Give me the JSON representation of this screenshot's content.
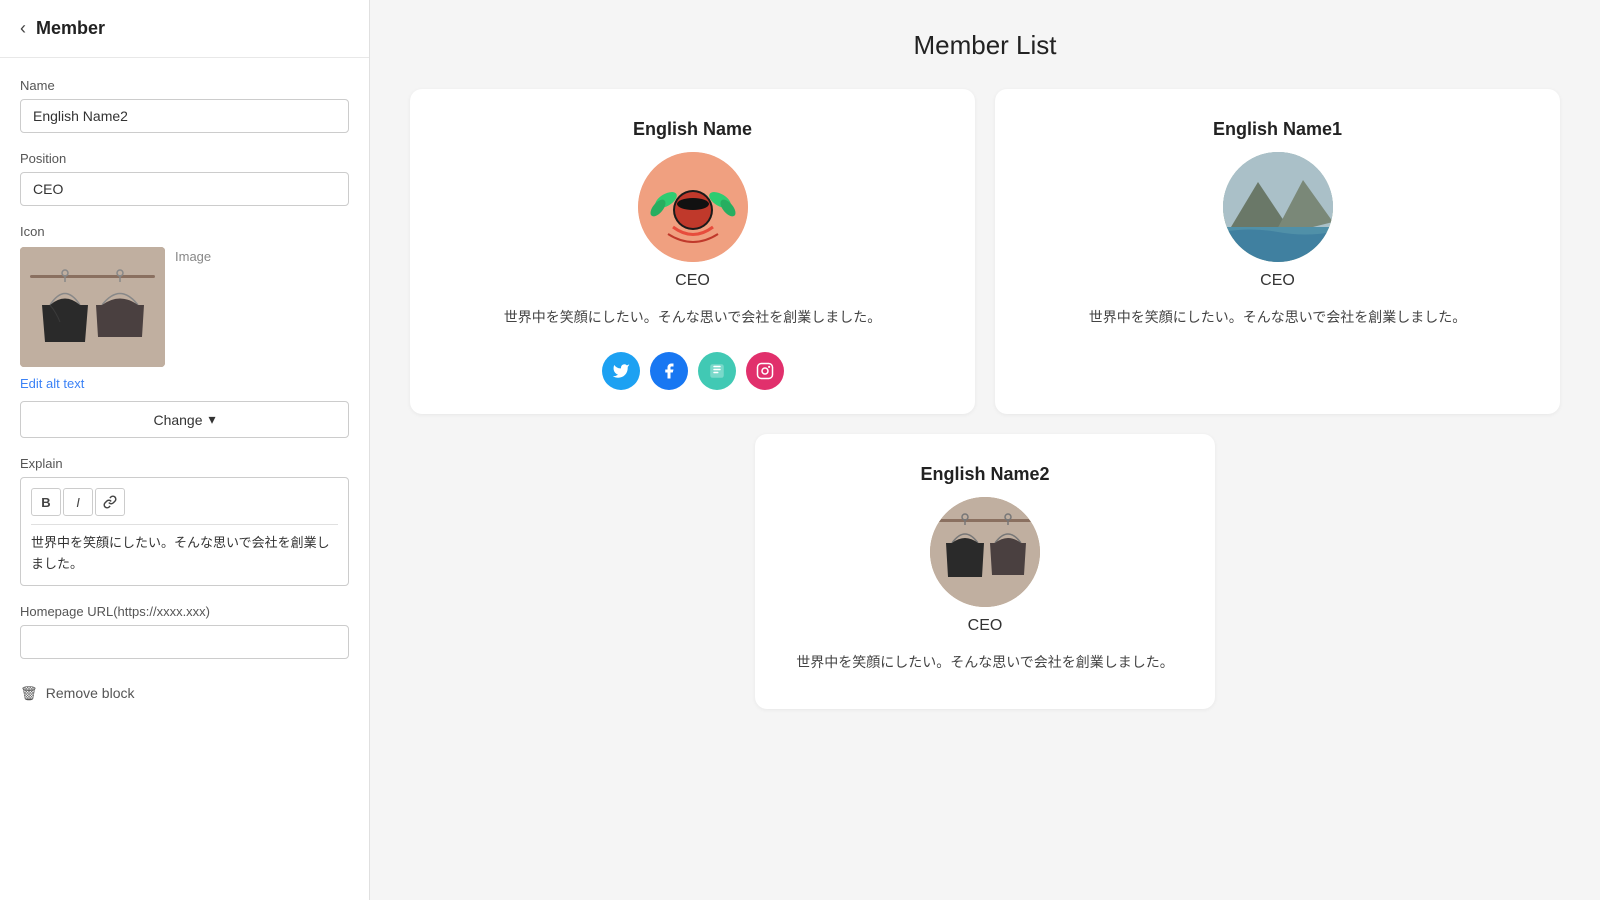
{
  "sidebar": {
    "title": "Member",
    "back_label": "‹",
    "name_label": "Name",
    "name_value": "English Name2",
    "position_label": "Position",
    "position_value": "CEO",
    "icon_label": "Icon",
    "image_label": "Image",
    "edit_alt_text_label": "Edit alt text",
    "change_button_label": "Change",
    "explain_label": "Explain",
    "bold_label": "B",
    "italic_label": "I",
    "link_label": "🔗",
    "explain_text": "世界中を笑顔にしたい。そんな思いで会社を創業しました。",
    "homepage_label": "Homepage URL(https://xxxx.xxx)",
    "homepage_placeholder": "",
    "remove_block_label": "Remove block"
  },
  "main": {
    "page_title": "Member List",
    "members": [
      {
        "id": "member-1",
        "name": "English Name",
        "position": "CEO",
        "desc": "世界中を笑顔にしたい。そんな思いで会社を創業しました。",
        "has_social": true,
        "avatar_type": "decorative-1"
      },
      {
        "id": "member-2",
        "name": "English Name1",
        "position": "CEO",
        "desc": "世界中を笑顔にしたい。そんな思いで会社を創業しました。",
        "has_social": false,
        "avatar_type": "landscape-1"
      },
      {
        "id": "member-3",
        "name": "English Name2",
        "position": "CEO",
        "desc": "世界中を笑顔にしたい。そんな思いで会社を創業しました。",
        "has_social": false,
        "avatar_type": "hanger-1"
      }
    ],
    "social_icons": {
      "twitter": "🐦",
      "facebook": "f",
      "note": "n",
      "instagram": "📷"
    }
  }
}
